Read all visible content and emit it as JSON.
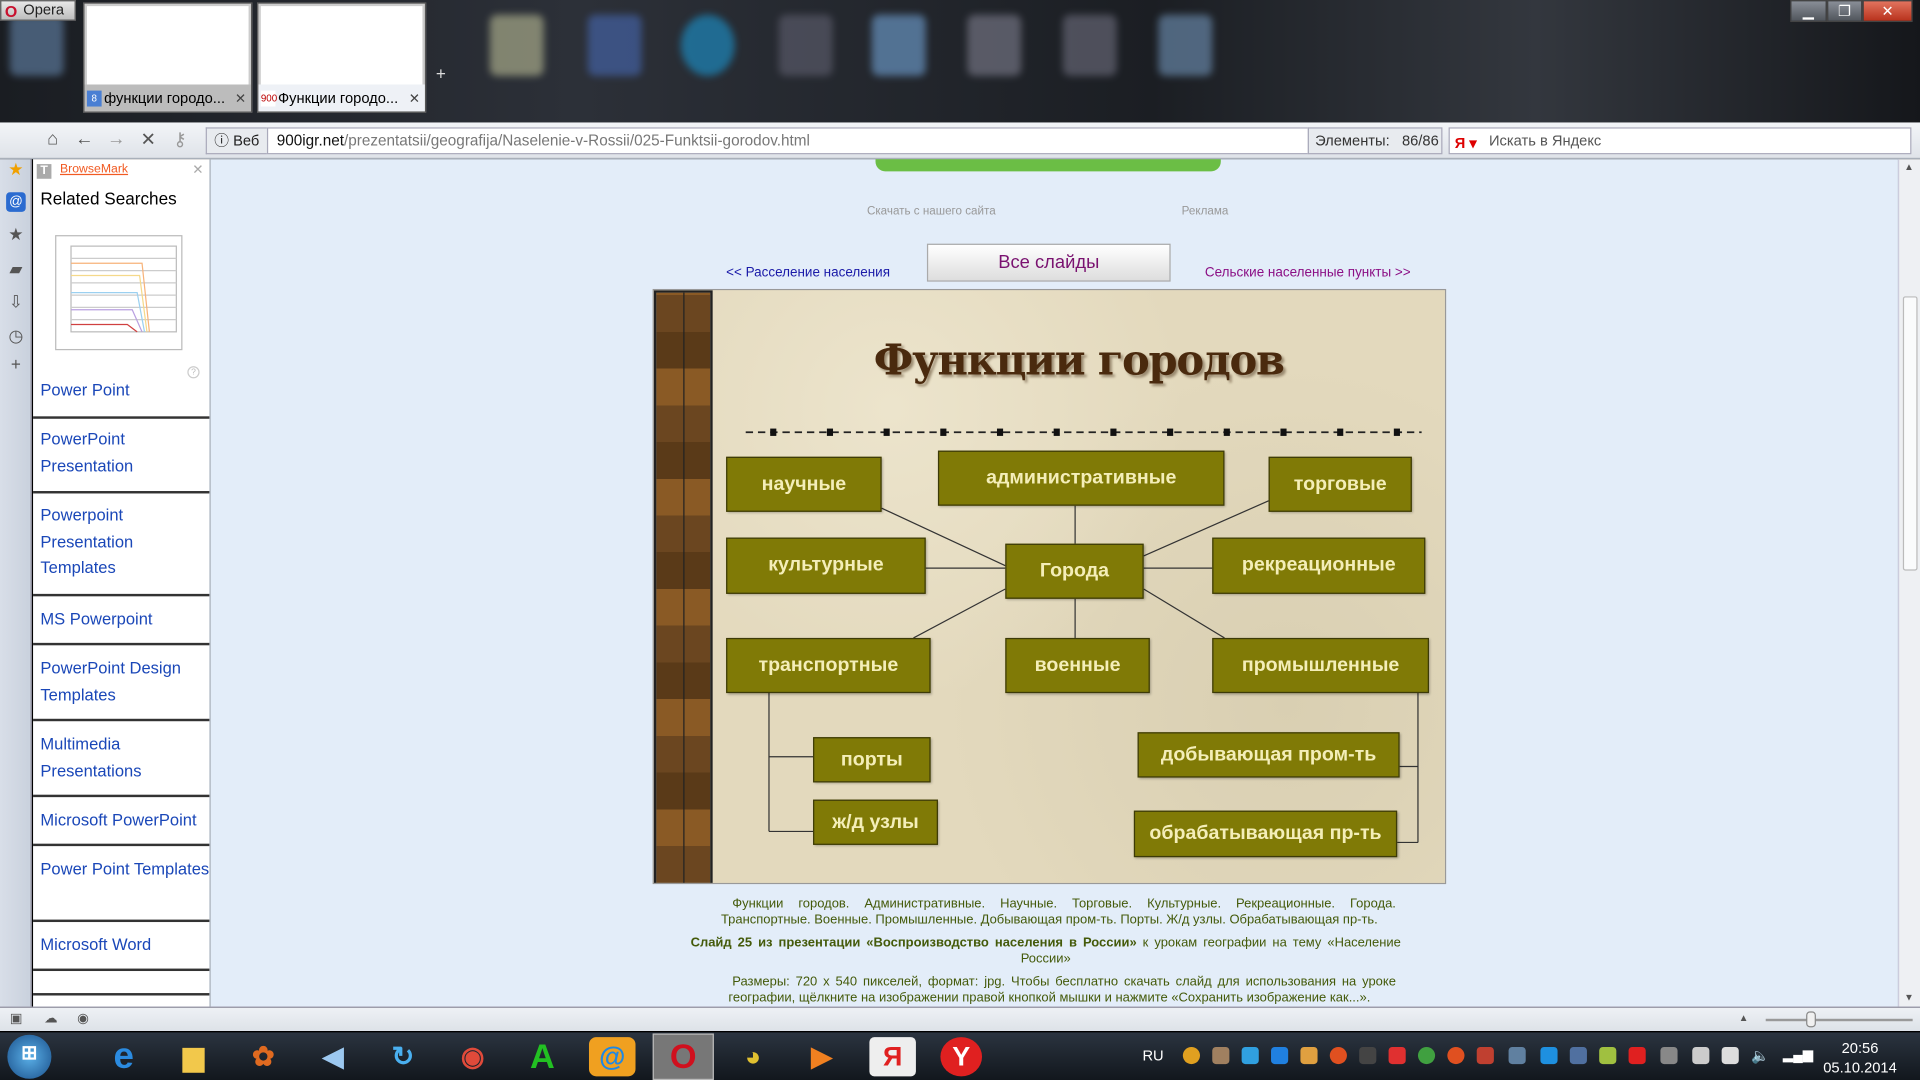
{
  "browser": {
    "menu_label": "Opera",
    "tabs": [
      {
        "title": "функции городо...",
        "active": false
      },
      {
        "title": "Функции городо...",
        "active": true,
        "favicon": "900 игр"
      }
    ],
    "window_controls": [
      "minimize",
      "restore",
      "close"
    ],
    "address": {
      "mode_label": "Веб",
      "url_domain": "900igr.net",
      "url_path": "/prezentatsii/geografija/Naselenie-v-Rossii/025-Funktsii-gorodov.html",
      "elements_label": "Элементы:",
      "elements_count": "86/86",
      "search_placeholder": "Искать в Яндекс"
    },
    "nav_icons": [
      "home-icon",
      "back-icon",
      "forward-icon",
      "stop-icon",
      "key-icon"
    ]
  },
  "sidebar": {
    "brand": "BrowseMark",
    "heading": "Related Searches",
    "items": [
      "Power Point",
      "PowerPoint Presentation",
      "Powerpoint Presentation Templates",
      "MS Powerpoint",
      "PowerPoint Design Templates",
      "Multimedia Presentations",
      "Microsoft PowerPoint",
      "Power Point Templates",
      "Microsoft Word"
    ]
  },
  "page": {
    "download_text": "Скачать с нашего сайта",
    "ad_text": "Реклама",
    "prev_link": "<<  Расселение населения",
    "next_link": "Сельские населенные пункты  >>",
    "all_slides_button": "Все слайды",
    "slide": {
      "title": "Функции городов",
      "center": "Города",
      "boxes": {
        "scientific": "научные",
        "administrative": "административные",
        "trade": "торговые",
        "cultural": "культурные",
        "recreational": "рекреационные",
        "transport": "транспортные",
        "military": "военные",
        "industrial": "промышленные",
        "ports": "порты",
        "rail": "ж/д узлы",
        "mining": "добывающая пром-ть",
        "processing": "обрабатывающая пр-ть"
      }
    },
    "caption_keywords": "Функции городов. Административные. Научные. Торговые. Культурные. Рекреационные. Города. Транспортные. Военные. Промышленные. Добывающая пром-ть. Порты. Ж/д узлы. Обрабатывающая пр-ть.",
    "caption_slide_bold": "Слайд 25 из презентации «Воспроизводство населения в России»",
    "caption_slide_rest": " к урокам географии на тему «Население России»",
    "caption_size": "Размеры: 720 х 540 пикселей, формат: jpg. Чтобы бесплатно скачать слайд для использования на уроке географии, щёлкните на изображении правой кнопкой мышки и нажмите «Сохранить изображение как...»."
  },
  "taskbar": {
    "apps": [
      "start",
      "internet-explorer",
      "explorer",
      "paint",
      "sound",
      "update",
      "chrome",
      "a-app",
      "mail-agent",
      "opera",
      "chart-app",
      "media-player",
      "yandex",
      "yandex-browser"
    ],
    "language": "RU",
    "time": "20:56",
    "date": "05.10.2014"
  },
  "colors": {
    "box_fill": "#807a06",
    "box_text": "#f4eeb8",
    "content_bg": "#e3edf9",
    "green_bar": "#6bbe45"
  }
}
